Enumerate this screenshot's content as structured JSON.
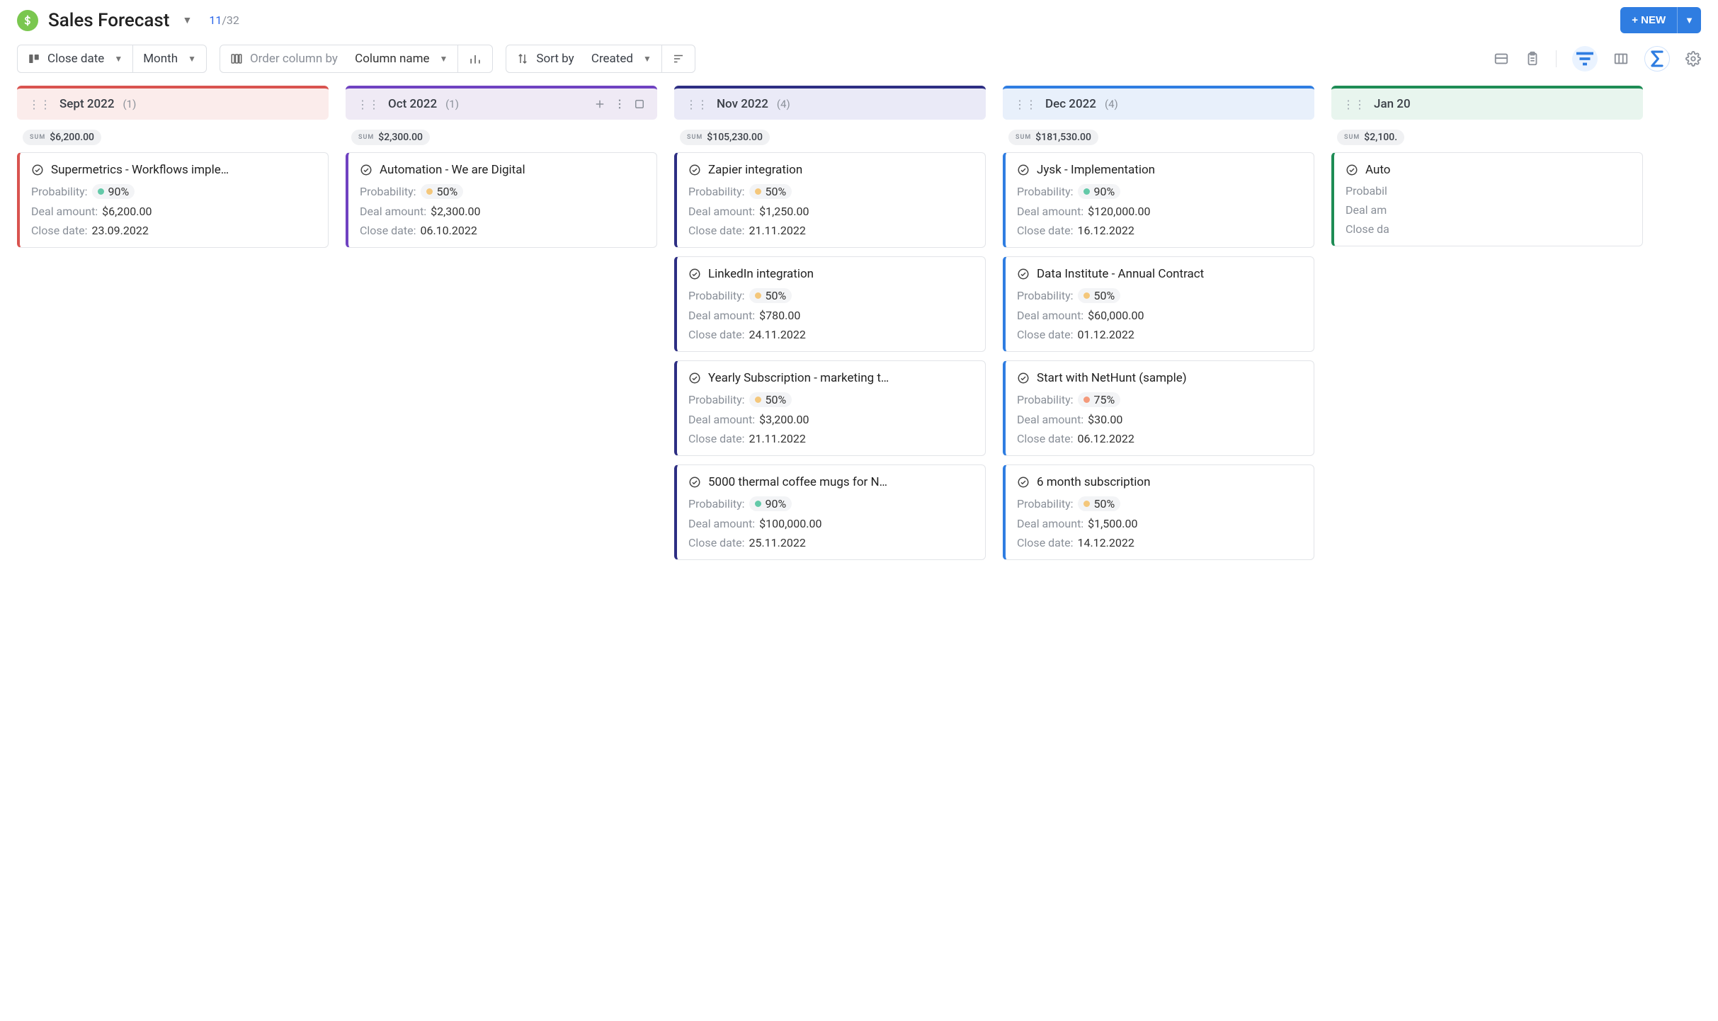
{
  "header": {
    "title": "Sales Forecast",
    "counter_visible": "11",
    "counter_total": "32",
    "new_button_label": "+ NEW"
  },
  "toolbar": {
    "close_date_label": "Close date",
    "period_label": "Month",
    "order_prefix": "Order column by",
    "order_value": "Column name",
    "sort_prefix": "Sort by",
    "sort_value": "Created"
  },
  "labels": {
    "sum": "SUM",
    "probability": "Probability:",
    "deal_amount": "Deal amount:",
    "close_date": "Close date:"
  },
  "probability_colors": {
    "90": "#63c9a8",
    "50": "#f4c77b",
    "75": "#f49a7b"
  },
  "columns": [
    {
      "title": "Sept 2022",
      "count": "(1)",
      "sum": "$6,200.00",
      "hover": false,
      "cards": [
        {
          "name": "Supermetrics - Workflows imple…",
          "probability": "90%",
          "prob_key": "90",
          "amount": "$6,200.00",
          "close": "23.09.2022"
        }
      ]
    },
    {
      "title": "Oct 2022",
      "count": "(1)",
      "sum": "$2,300.00",
      "hover": true,
      "cards": [
        {
          "name": "Automation - We are Digital",
          "probability": "50%",
          "prob_key": "50",
          "amount": "$2,300.00",
          "close": "06.10.2022"
        }
      ]
    },
    {
      "title": "Nov 2022",
      "count": "(4)",
      "sum": "$105,230.00",
      "hover": false,
      "cards": [
        {
          "name": "Zapier integration",
          "probability": "50%",
          "prob_key": "50",
          "amount": "$1,250.00",
          "close": "21.11.2022"
        },
        {
          "name": "LinkedIn integration",
          "probability": "50%",
          "prob_key": "50",
          "amount": "$780.00",
          "close": "24.11.2022"
        },
        {
          "name": "Yearly Subscription - marketing t…",
          "probability": "50%",
          "prob_key": "50",
          "amount": "$3,200.00",
          "close": "21.11.2022"
        },
        {
          "name": "5000 thermal coffee mugs for N…",
          "probability": "90%",
          "prob_key": "90",
          "amount": "$100,000.00",
          "close": "25.11.2022"
        }
      ]
    },
    {
      "title": "Dec 2022",
      "count": "(4)",
      "sum": "$181,530.00",
      "hover": false,
      "cards": [
        {
          "name": "Jysk - Implementation",
          "probability": "90%",
          "prob_key": "90",
          "amount": "$120,000.00",
          "close": "16.12.2022"
        },
        {
          "name": "Data Institute - Annual Contract",
          "probability": "50%",
          "prob_key": "50",
          "amount": "$60,000.00",
          "close": "01.12.2022"
        },
        {
          "name": "Start with NetHunt (sample)",
          "probability": "75%",
          "prob_key": "75",
          "amount": "$30.00",
          "close": "06.12.2022"
        },
        {
          "name": "6 month subscription",
          "probability": "50%",
          "prob_key": "50",
          "amount": "$1,500.00",
          "close": "14.12.2022"
        }
      ]
    },
    {
      "title": "Jan 20",
      "count": "",
      "sum": "$2,100.",
      "hover": false,
      "cards": [
        {
          "name": "Auto",
          "probability": "",
          "prob_key": "50",
          "amount": "",
          "close": "",
          "partial_labels": {
            "prob": "Probabil",
            "amount": "Deal am",
            "close": "Close da"
          }
        }
      ]
    }
  ]
}
